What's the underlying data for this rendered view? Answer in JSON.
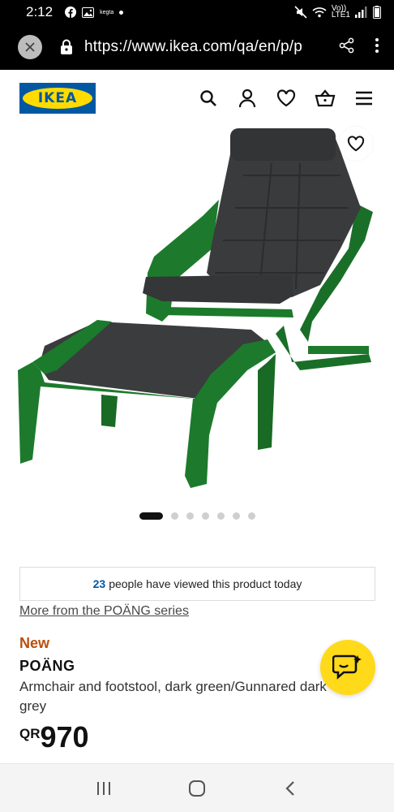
{
  "status_bar": {
    "time": "2:12",
    "notification_label": "kegta",
    "network_label_top": "Vo))",
    "network_label_bottom": "LTE1"
  },
  "browser": {
    "url": "https://www.ikea.com/qa/en/p/p"
  },
  "header": {
    "logo_text": "IKEA"
  },
  "carousel": {
    "total_dots": 7,
    "active_index": 0
  },
  "product": {
    "viewed_count": "23",
    "viewed_text": "people have viewed this product today",
    "series_link": "More from the POÄNG series",
    "badge": "New",
    "name": "POÄNG",
    "description": "Armchair and footstool, dark green/Gunnared dark grey",
    "currency": "QR",
    "price": "970"
  },
  "colors": {
    "ikea_blue": "#0058a3",
    "ikea_yellow": "#ffdb00",
    "new_orange": "#b7500e",
    "chair_green": "#1b7a2b",
    "cushion_grey": "#3a3b3d"
  },
  "icons": {
    "header": [
      "search-icon",
      "account-icon",
      "heart-icon",
      "basket-icon",
      "menu-icon"
    ],
    "nav": [
      "recent-apps-icon",
      "home-icon",
      "back-icon"
    ]
  }
}
